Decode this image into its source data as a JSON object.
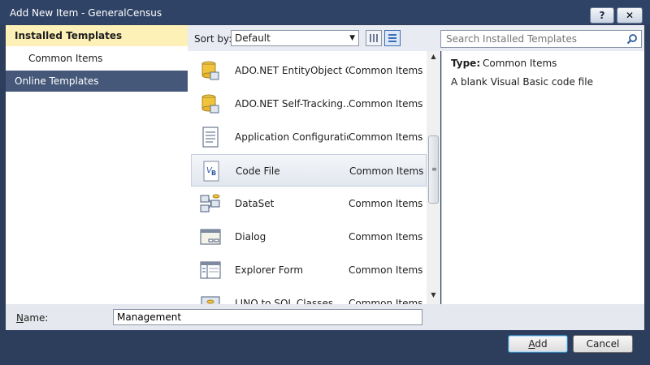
{
  "window": {
    "title": "Add New Item - GeneralCensus",
    "help_label": "?",
    "close_label": "✕"
  },
  "sidebar": {
    "items": [
      {
        "label": "Installed Templates"
      },
      {
        "label": "Common Items"
      },
      {
        "label": "Online Templates"
      }
    ]
  },
  "toolbar": {
    "sort_label": "Sort by:",
    "sort_value": "Default",
    "search_placeholder": "Search Installed Templates"
  },
  "templates": {
    "items": [
      {
        "name": "ADO.NET EntityObject G...",
        "category": "Common Items",
        "icon": "database-icon"
      },
      {
        "name": "ADO.NET Self-Tracking...",
        "category": "Common Items",
        "icon": "database-icon"
      },
      {
        "name": "Application Configuratio...",
        "category": "Common Items",
        "icon": "config-file-icon"
      },
      {
        "name": "Code File",
        "category": "Common Items",
        "icon": "vb-code-file-icon"
      },
      {
        "name": "DataSet",
        "category": "Common Items",
        "icon": "dataset-icon"
      },
      {
        "name": "Dialog",
        "category": "Common Items",
        "icon": "dialog-icon"
      },
      {
        "name": "Explorer Form",
        "category": "Common Items",
        "icon": "explorer-form-icon"
      },
      {
        "name": "LINQ to SQL Classes",
        "category": "Common Items",
        "icon": "linq-icon"
      }
    ]
  },
  "details": {
    "type_label": "Type:",
    "type_value": "Common Items",
    "description": "A blank Visual Basic code file"
  },
  "name_field": {
    "label_prefix": "N",
    "label_rest": "ame:",
    "value": "Management"
  },
  "buttons": {
    "add_prefix": "A",
    "add_rest": "dd",
    "cancel": "Cancel"
  },
  "colors": {
    "accent": "#45587a",
    "highlight": "#fdf1b8"
  }
}
